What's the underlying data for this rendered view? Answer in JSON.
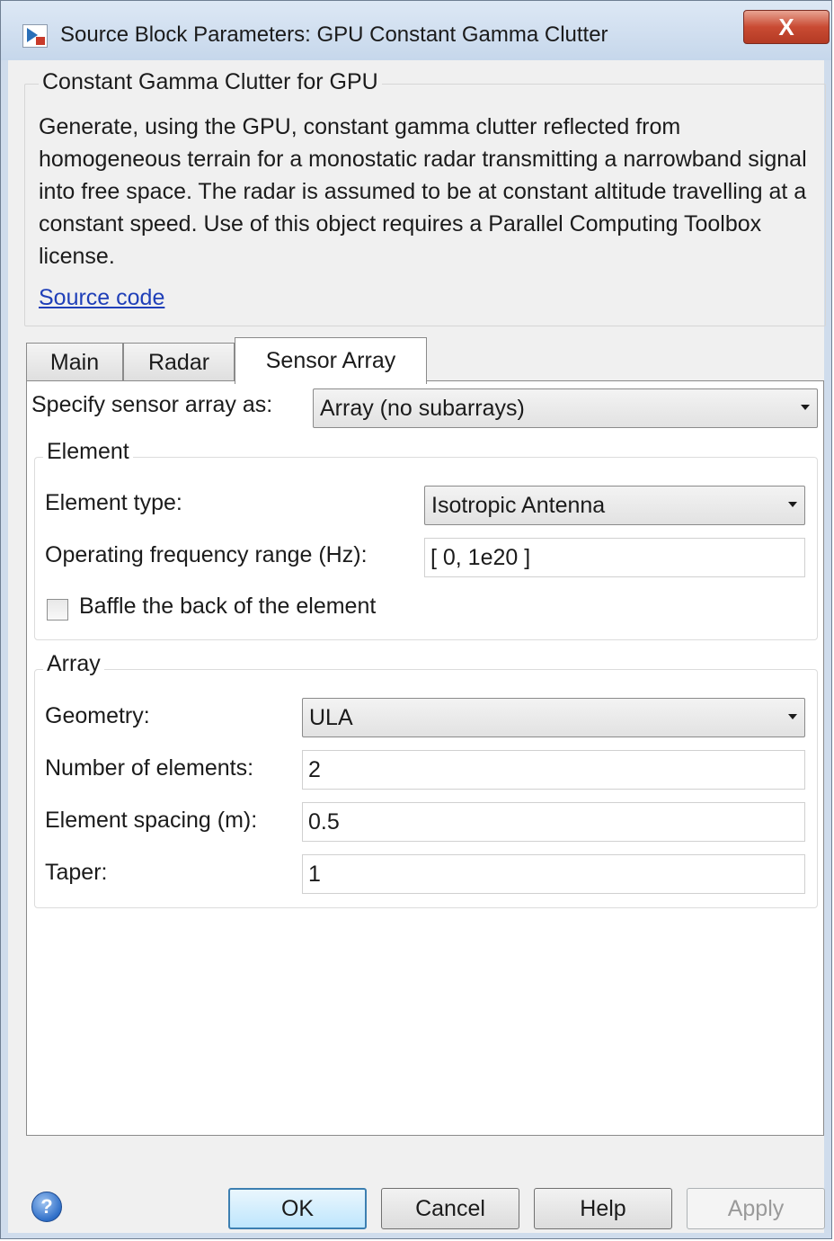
{
  "window": {
    "title": "Source Block Parameters: GPU Constant Gamma Clutter",
    "close_glyph": "X"
  },
  "description": {
    "group_title": "Constant Gamma Clutter for GPU",
    "text": "Generate, using the GPU, constant gamma clutter reflected from homogeneous terrain for a monostatic radar transmitting a narrowband signal into free space. The radar is assumed to be at constant altitude travelling at a constant speed. Use of this object requires a Parallel Computing Toolbox license.",
    "source_link": "Source code"
  },
  "tabs": [
    {
      "label": "Main",
      "active": false
    },
    {
      "label": "Radar",
      "active": false
    },
    {
      "label": "Sensor Array",
      "active": true
    }
  ],
  "sensor_array": {
    "specify_label": "Specify sensor array as:",
    "specify_value": "Array (no subarrays)",
    "element_group": {
      "title": "Element",
      "type_label": "Element type:",
      "type_value": "Isotropic Antenna",
      "freq_label": "Operating frequency range (Hz):",
      "freq_value": "[ 0, 1e20 ]",
      "baffle_label": "Baffle the back of the element",
      "baffle_checked": false
    },
    "array_group": {
      "title": "Array",
      "geometry_label": "Geometry:",
      "geometry_value": "ULA",
      "num_elements_label": "Number of elements:",
      "num_elements_value": "2",
      "spacing_label": "Element spacing (m):",
      "spacing_value": "0.5",
      "taper_label": "Taper:",
      "taper_value": "1"
    }
  },
  "buttons": {
    "help_icon_glyph": "?",
    "ok": "OK",
    "cancel": "Cancel",
    "help": "Help",
    "apply": "Apply"
  },
  "colors": {
    "link": "#1f3fb8",
    "close_button": "#c94b33",
    "default_button_border": "#3c7fb1"
  }
}
